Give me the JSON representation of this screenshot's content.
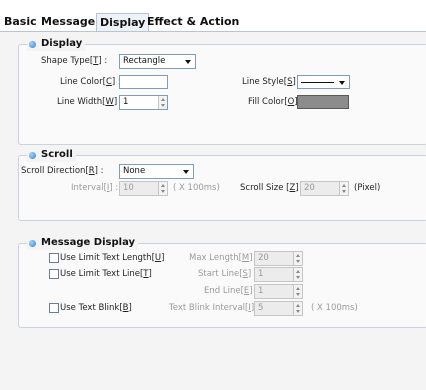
{
  "tabs": [
    {
      "label": "Basic"
    },
    {
      "label": "Message"
    },
    {
      "label": "Display",
      "active": true
    },
    {
      "label": "Effect & Action"
    }
  ],
  "display_group": {
    "title": "Display",
    "shape_type": {
      "label": "Shape Type",
      "key": "T",
      "value": "Rectangle"
    },
    "line_color": {
      "label": "Line Color",
      "key": "C",
      "color": "#ffffff"
    },
    "line_style": {
      "label": "Line Style",
      "key": "S",
      "value": "solid"
    },
    "line_width": {
      "label": "Line Width",
      "key": "W",
      "value": "1"
    },
    "fill_color": {
      "label": "Fill Color",
      "key": "O",
      "color": "#8c8c8c"
    }
  },
  "scroll_group": {
    "title": "Scroll",
    "direction": {
      "label": "Scroll Direction",
      "key": "R",
      "value": "None"
    },
    "interval": {
      "label": "Interval",
      "key": "I",
      "value": "10",
      "unit": "( X 100ms)"
    },
    "size": {
      "label": "Scroll Size",
      "key": "Z",
      "value": "20",
      "unit": "(Pixel)"
    }
  },
  "message_group": {
    "title": "Message Display",
    "limit_length": {
      "label": "Use Limit Text Length",
      "key": "U",
      "checked": false
    },
    "max_length": {
      "label": "Max Length",
      "key": "M",
      "value": "20"
    },
    "limit_line": {
      "label": "Use Limit Text Line",
      "key": "T",
      "checked": false
    },
    "start_line": {
      "label": "Start Line",
      "key": "S",
      "value": "1"
    },
    "end_line": {
      "label": "End Line",
      "key": "E",
      "value": "1"
    },
    "text_blink": {
      "label": "Use Text Blink",
      "key": "B",
      "checked": false
    },
    "blink_interval": {
      "label": "Text Blink Interval",
      "key": "I",
      "value": "5",
      "unit": "( X 100ms)"
    }
  },
  "colors": {
    "accent": "#2f7fd0",
    "border": "#c9d2dd",
    "field_border": "#7f9db9"
  }
}
